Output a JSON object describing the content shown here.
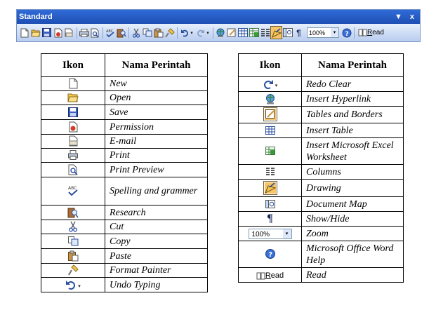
{
  "toolbar": {
    "title": "Standard",
    "controls": "▼ x",
    "zoom_value": "100%",
    "read_label": "Read",
    "read_underline": "R",
    "read_rest": "ead"
  },
  "left_table": {
    "col_icon": "Ikon",
    "col_name": "Nama Perintah",
    "rows": [
      {
        "name": "New",
        "icon": "new-document-icon"
      },
      {
        "name": "Open",
        "icon": "open-folder-icon"
      },
      {
        "name": "Save",
        "icon": "save-icon"
      },
      {
        "name": "Permission",
        "icon": "permission-icon"
      },
      {
        "name": "E-mail",
        "icon": "email-icon"
      },
      {
        "name": "Print",
        "icon": "print-icon"
      },
      {
        "name": "Print Preview",
        "icon": "print-preview-icon"
      },
      {
        "name": "Spelling and grammer",
        "icon": "spelling-icon"
      },
      {
        "name": "Research",
        "icon": "research-icon"
      },
      {
        "name": "Cut",
        "icon": "cut-icon"
      },
      {
        "name": "Copy",
        "icon": "copy-icon"
      },
      {
        "name": "Paste",
        "icon": "paste-icon"
      },
      {
        "name": "Format Painter",
        "icon": "format-painter-icon"
      },
      {
        "name": "Undo Typing",
        "icon": "undo-icon"
      }
    ]
  },
  "right_table": {
    "col_icon": "Ikon",
    "col_name": "Nama Perintah",
    "rows": [
      {
        "name": "Redo Clear",
        "icon": "redo-icon"
      },
      {
        "name": "Insert Hyperlink",
        "icon": "hyperlink-icon"
      },
      {
        "name": "Tables and Borders",
        "icon": "tables-borders-icon"
      },
      {
        "name": "Insert Table",
        "icon": "insert-table-icon"
      },
      {
        "name": "Insert Microsoft Excel  Worksheet",
        "icon": "excel-worksheet-icon"
      },
      {
        "name": "Columns",
        "icon": "columns-icon"
      },
      {
        "name": "Drawing",
        "icon": "drawing-icon"
      },
      {
        "name": "Document Map",
        "icon": "document-map-icon"
      },
      {
        "name": "Show/Hide",
        "icon": "pilcrow-icon"
      },
      {
        "name": "Zoom",
        "icon": "zoom-box",
        "zoom_value": "100%"
      },
      {
        "name": "Microsoft Office Word Help",
        "icon": "help-icon"
      },
      {
        "name": "Read",
        "icon": "read-button",
        "read_underline": "R",
        "read_rest": "ead"
      }
    ]
  },
  "colors": {
    "title_bar": "#2f6bd8",
    "toolbar_bg": "#c4d8f4",
    "active_highlight": "#f7c467"
  }
}
